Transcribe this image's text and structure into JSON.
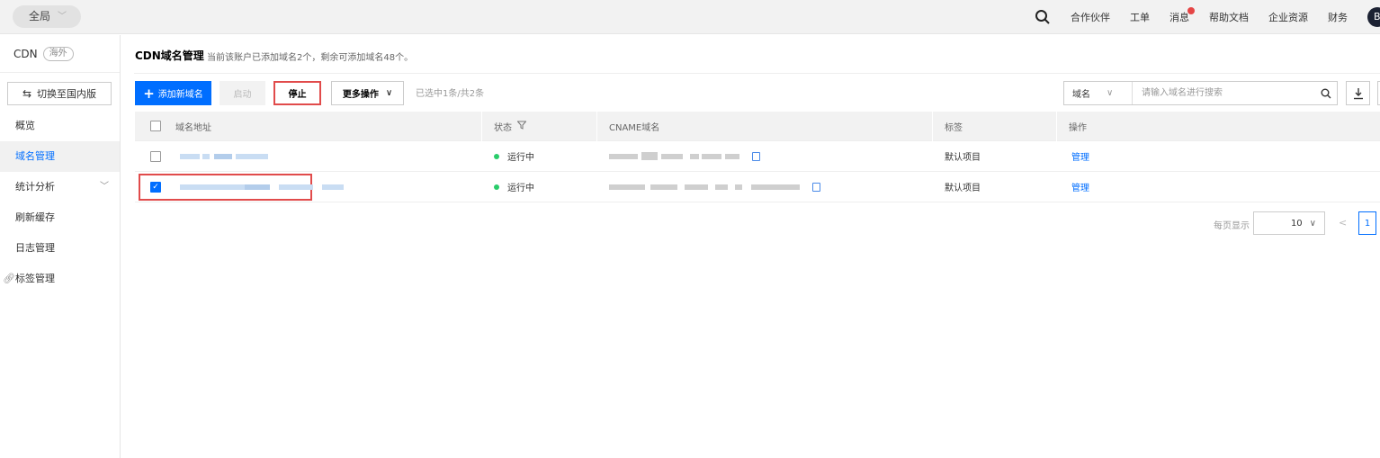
{
  "topbar": {
    "region_label": "全局",
    "nav_items": [
      "合作伙伴",
      "工单",
      "消息",
      "帮助文档",
      "企业资源",
      "财务"
    ],
    "avatar_initial": "B"
  },
  "sidebar": {
    "product": "CDN",
    "badge": "海外",
    "switch_label": "切换至国内版",
    "items": [
      {
        "label": "概览"
      },
      {
        "label": "域名管理",
        "active": true
      },
      {
        "label": "统计分析"
      },
      {
        "label": "刷新缓存"
      },
      {
        "label": "日志管理"
      },
      {
        "label": "标签管理"
      }
    ]
  },
  "main": {
    "title": "CDN域名管理",
    "note": "当前该账户已添加域名2个，剩余可添加域名48个。",
    "toolbar": {
      "add_label": "添加新域名",
      "start_label": "启动",
      "stop_label": "停止",
      "more_label": "更多操作",
      "selected_info": "已选中1条/共2条"
    },
    "search": {
      "field": "域名",
      "placeholder": "请输入域名进行搜索"
    },
    "table": {
      "headers": {
        "domain": "域名地址",
        "status": "状态",
        "cname": "CNAME域名",
        "tag": "标签",
        "action": "操作"
      },
      "rows": [
        {
          "checked": false,
          "status": "运行中",
          "tag": "默认项目",
          "action": "管理"
        },
        {
          "checked": true,
          "status": "运行中",
          "tag": "默认项目",
          "action": "管理"
        }
      ]
    },
    "pager": {
      "label": "每页显示",
      "page_size": "10",
      "prev": "<",
      "current_page": "1"
    }
  },
  "colors": {
    "accent": "#006eff",
    "status_running": "#29cc6a",
    "highlight": "#e14b4b"
  }
}
